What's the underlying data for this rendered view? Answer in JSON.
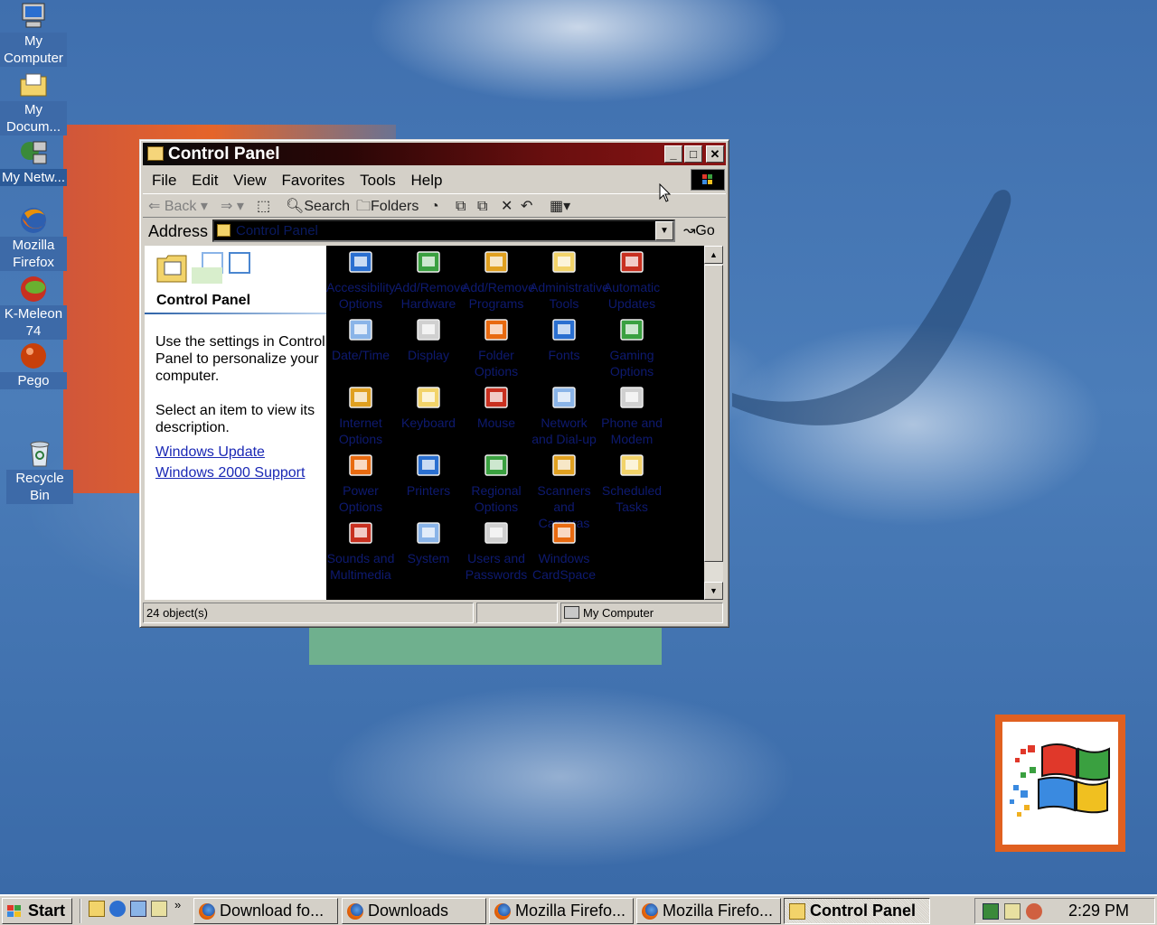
{
  "desktop": {
    "icons": [
      {
        "label": "My Computer",
        "icon": "my-computer-icon"
      },
      {
        "label": "My Docum...",
        "icon": "my-documents-icon"
      },
      {
        "label": "My Netw...",
        "icon": "network-places-icon"
      },
      {
        "label": "Mozilla Firefox",
        "icon": "firefox-icon"
      },
      {
        "label": "K-Meleon 74",
        "icon": "k-meleon-icon"
      },
      {
        "label": "Pego",
        "icon": "pego-icon"
      },
      {
        "label": "Recycle Bin",
        "icon": "recycle-bin-icon"
      }
    ]
  },
  "window": {
    "title": "Control Panel",
    "controls": {
      "minimize": "_",
      "maximize": "□",
      "close": "✕"
    },
    "menu": [
      "File",
      "Edit",
      "View",
      "Favorites",
      "Tools",
      "Help"
    ],
    "toolbar": {
      "back": "Back",
      "search": "Search",
      "folders": "Folders"
    },
    "address": {
      "label": "Address",
      "value": "Control Panel",
      "go": "Go"
    },
    "left_pane": {
      "title": "Control Panel",
      "description": "Use the settings in Control Panel to personalize your computer.",
      "select_hint": "Select an item to view its description.",
      "links": [
        "Windows Update",
        "Windows 2000 Support"
      ]
    },
    "items": [
      {
        "label": "Accessibility Options",
        "icon": "accessibility-icon"
      },
      {
        "label": "Add/Remove Hardware",
        "icon": "add-hardware-icon"
      },
      {
        "label": "Add/Remove Programs",
        "icon": "add-programs-icon"
      },
      {
        "label": "Administrative Tools",
        "icon": "admin-tools-icon"
      },
      {
        "label": "Automatic Updates",
        "icon": "automatic-updates-icon"
      },
      {
        "label": "Date/Time",
        "icon": "date-time-icon"
      },
      {
        "label": "Display",
        "icon": "display-icon"
      },
      {
        "label": "Folder Options",
        "icon": "folder-options-icon"
      },
      {
        "label": "Fonts",
        "icon": "fonts-icon"
      },
      {
        "label": "Gaming Options",
        "icon": "gaming-options-icon"
      },
      {
        "label": "Internet Options",
        "icon": "internet-options-icon"
      },
      {
        "label": "Keyboard",
        "icon": "keyboard-icon"
      },
      {
        "label": "Mouse",
        "icon": "mouse-icon"
      },
      {
        "label": "Network and Dial-up",
        "icon": "network-icon"
      },
      {
        "label": "Phone and Modem",
        "icon": "phone-modem-icon"
      },
      {
        "label": "Power Options",
        "icon": "power-options-icon"
      },
      {
        "label": "Printers",
        "icon": "printers-icon"
      },
      {
        "label": "Regional Options",
        "icon": "regional-options-icon"
      },
      {
        "label": "Scanners and Cameras",
        "icon": "scanners-icon"
      },
      {
        "label": "Scheduled Tasks",
        "icon": "scheduled-tasks-icon"
      },
      {
        "label": "Sounds and Multimedia",
        "icon": "sounds-icon"
      },
      {
        "label": "System",
        "icon": "system-icon"
      },
      {
        "label": "Users and Passwords",
        "icon": "users-icon"
      },
      {
        "label": "Windows CardSpace",
        "icon": "cardspace-icon"
      }
    ],
    "status": {
      "objects": "24 object(s)",
      "zone": "My Computer"
    }
  },
  "taskbar": {
    "start": "Start",
    "tasks": [
      {
        "label": "Download fo..."
      },
      {
        "label": "Downloads"
      },
      {
        "label": "Mozilla Firefo..."
      },
      {
        "label": "Mozilla Firefo..."
      },
      {
        "label": "Control Panel"
      }
    ],
    "clock": "2:29 PM"
  },
  "colors": {
    "titlebar_start": "#0a0a0a",
    "titlebar_end": "#8a1414",
    "desktop": "#3d6aa8",
    "link": "#1a28b5"
  }
}
